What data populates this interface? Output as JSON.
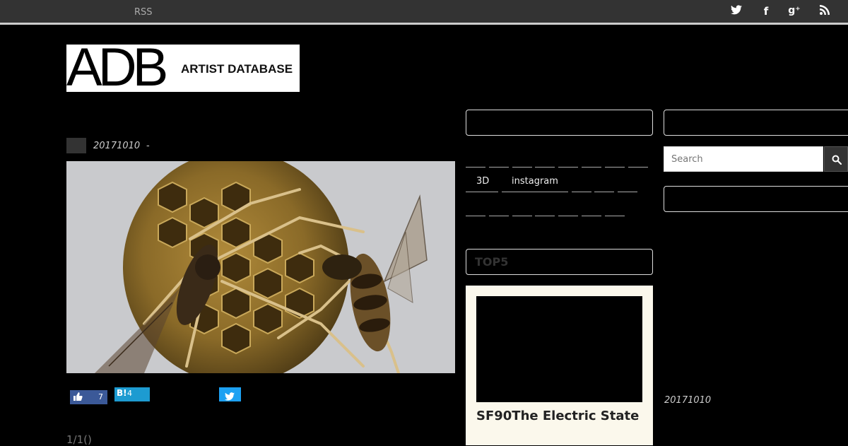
{
  "topbar": {
    "rss_label": "RSS",
    "social_icons": [
      "twitter-icon",
      "facebook-icon",
      "google-plus-icon",
      "rss-icon"
    ]
  },
  "logo": {
    "mark": "ADB",
    "subtitle": "ARTIST DATABASE"
  },
  "post": {
    "date": "20171010",
    "separator": "-",
    "image": "wasp-sculpture-on-nest",
    "share": {
      "like_count": "7",
      "hatena_label": "B!",
      "hatena_count": "4"
    },
    "pager": "1/1()"
  },
  "sidebar": {
    "tags_row2": [
      "3D",
      "instagram"
    ],
    "top5_label": "TOP5",
    "top_card_title": "SF90The Electric State",
    "search_placeholder": "Search",
    "side_date": "20171010"
  },
  "colors": {
    "background": "#000000",
    "topbar": "#333333",
    "facebook": "#3b5998",
    "hatena": "#1d9bd1",
    "twitter": "#1da1f2",
    "card": "#fbf8ec"
  }
}
